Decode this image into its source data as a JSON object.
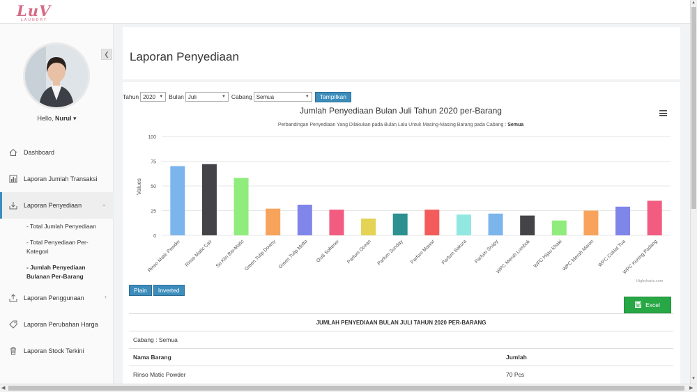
{
  "brand": {
    "name": "LuV",
    "tagline": "LAUNDRY"
  },
  "sidebar": {
    "greeting": "Hello,",
    "user": "Nurul",
    "items": [
      {
        "label": "Dashboard",
        "icon": "home-icon"
      },
      {
        "label": "Laporan Jumlah Transaksi",
        "icon": "bar-chart-icon"
      },
      {
        "label": "Laporan Penyediaan",
        "icon": "download-icon",
        "active": true
      },
      {
        "label": "Laporan Penggunaan",
        "icon": "upload-icon"
      },
      {
        "label": "Laporan Perubahan Harga",
        "icon": "tag-icon"
      },
      {
        "label": "Laporan Stock Terkini",
        "icon": "trash-icon"
      }
    ],
    "subitems": [
      "- Total Jumlah Penyediaan",
      "- Total Penyediaan Per-Kategori",
      "- Jumlah Penyediaan Bulanan Per-Barang"
    ]
  },
  "page": {
    "title": "Laporan Penyediaan"
  },
  "filters": {
    "tahun_label": "Tahun",
    "tahun_value": "2020",
    "bulan_label": "Bulan",
    "bulan_value": "Juli",
    "cabang_label": "Cabang",
    "cabang_value": "Semua",
    "submit_label": "Tampilkan"
  },
  "chart_data": {
    "type": "bar",
    "title": "Jumlah Penyediaan Bulan Juli Tahun 2020 per-Barang",
    "subtitle_prefix": "Perbandingan Penyediaan Yang Dilakukan pada Bulan Lalu Untuk Masing-Masing Barang pada Cabang : ",
    "subtitle_branch": "Semua",
    "ylabel": "Values",
    "ylim": [
      0,
      100
    ],
    "yticks": [
      0,
      25,
      50,
      75,
      100
    ],
    "grid": true,
    "credits": "Highcharts.com",
    "categories": [
      "Rinso Matic Powder",
      "Rinso Matic Cair",
      "So Klin Bio-Matic",
      "Green Tulip Downy",
      "Green Tulip Molto",
      "Oxi8 Softener",
      "Parfum Ocean",
      "Parfum Sunday",
      "Parfum Mawar",
      "Parfum Sakura",
      "Parfum Snapy",
      "WPC Merah Lombok",
      "WPC Hijau Khaki",
      "WPC Merah Maron",
      "WPC Coklat Tua",
      "WPC Kuning Padang"
    ],
    "values": [
      70,
      72,
      58,
      27,
      31,
      26,
      17,
      22,
      26,
      21,
      22,
      20,
      15,
      25,
      29,
      35
    ],
    "colors": [
      "#7cb5ec",
      "#434348",
      "#90ed7d",
      "#f7a35c",
      "#8085e9",
      "#f15c80",
      "#e4d354",
      "#2b908f",
      "#f45b5b",
      "#91e8e1",
      "#7cb5ec",
      "#434348",
      "#90ed7d",
      "#f7a35c",
      "#8085e9",
      "#f15c80"
    ]
  },
  "chart_controls": {
    "plain": "Plain",
    "inverted": "Inverted"
  },
  "export": {
    "label": "Excel"
  },
  "table": {
    "caption": "JUMLAH PENYEDIAAN BULAN JULI TAHUN 2020 PER-BARANG",
    "branch_line": "Cabang : Semua",
    "headers": [
      "Nama Barang",
      "Jumlah"
    ],
    "rows": [
      [
        "Rinso Matic Powder",
        "70 Pcs"
      ]
    ]
  }
}
